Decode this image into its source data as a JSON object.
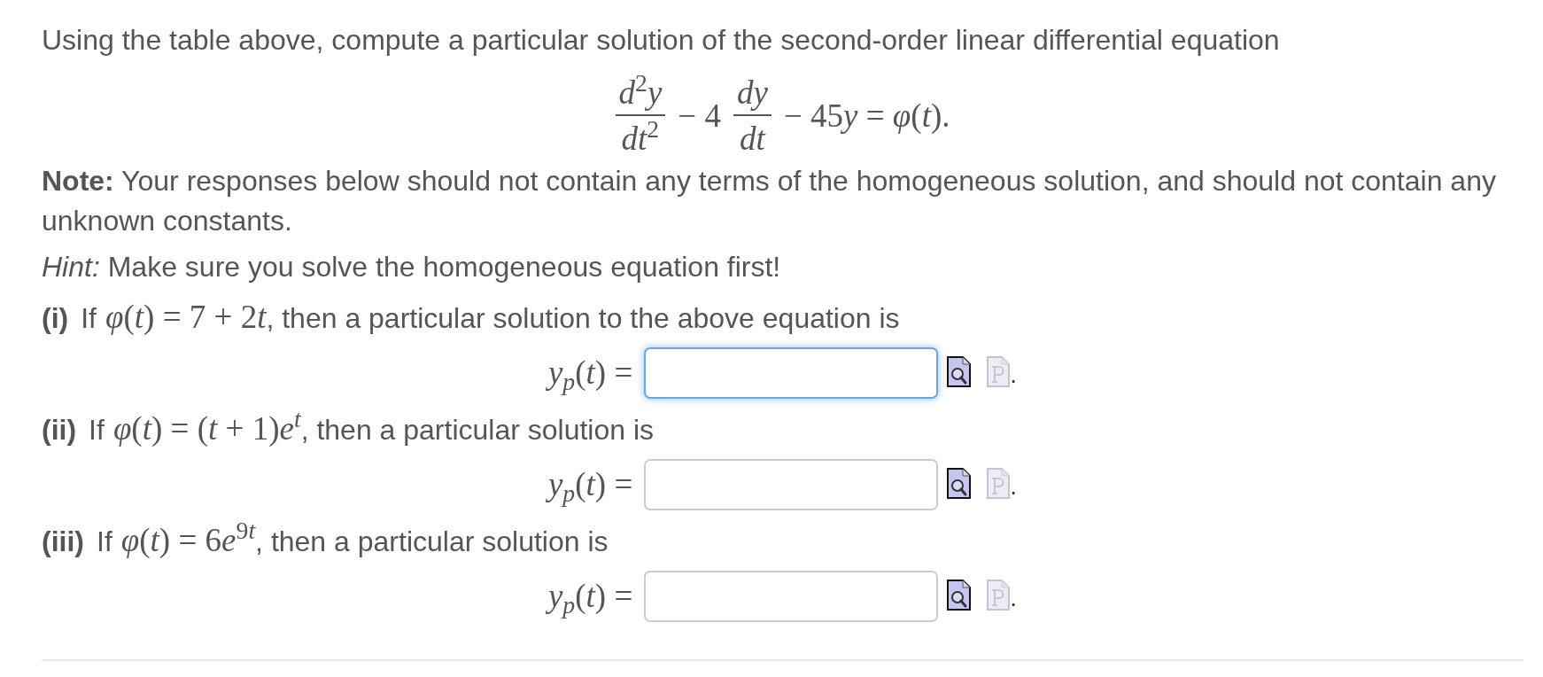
{
  "intro": "Using the table above, compute a particular solution of the second-order linear differential equation",
  "equation": [
    {
      "kind": "fraction",
      "numerator": "d$^{2}$y",
      "denominator": "dt$^{2}$"
    },
    {
      "kind": "math",
      "text": "− 4"
    },
    {
      "kind": "fraction",
      "numerator": "dy",
      "denominator": "dt"
    },
    {
      "kind": "math",
      "text": "− 45y = φ(t)."
    }
  ],
  "note": "**Note:** Your responses below should not contain any terms of the homogeneous solution, and should not contain any unknown constants.",
  "hint": "*Hint:* Make sure you solve the homogeneous equation first!",
  "parts": [
    {
      "label": "(i)",
      "lead": "If",
      "condition": "φ(t) = 7 + 2t",
      "tail": ", then a particular solution to the above equation is",
      "answer_label": "y$_{p}$(t) =",
      "answer": {
        "focused": true
      },
      "trailing": "."
    },
    {
      "label": "(ii)",
      "lead": "If",
      "condition": "φ(t) = (t + 1)e$^{t}$",
      "tail": ", then a particular solution is",
      "answer_label": "y$_{p}$(t) =",
      "answer": {
        "focused": false
      },
      "trailing": "."
    },
    {
      "label": "(iii)",
      "lead": "If",
      "condition": "φ(t) = 6e$^{9t}$",
      "tail": ", then a particular solution is",
      "answer_label": "y$_{p}$(t) =",
      "answer": {
        "focused": false
      },
      "trailing": "."
    }
  ]
}
